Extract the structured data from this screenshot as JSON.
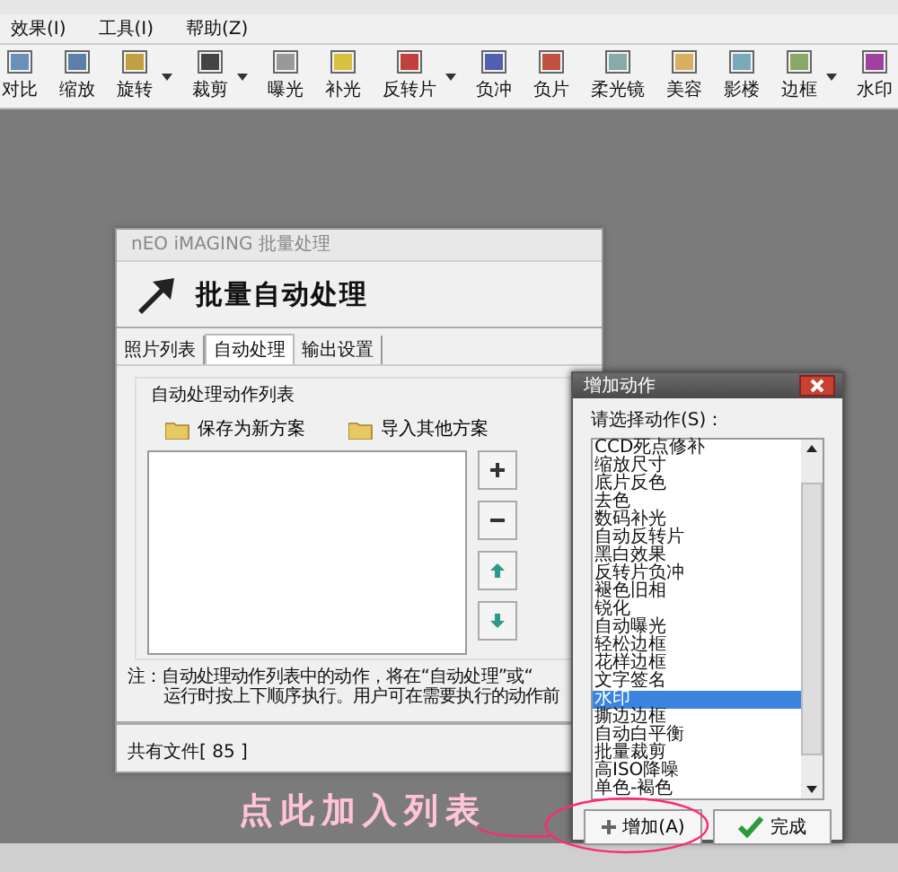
{
  "menu": [
    {
      "label": "效果(I)"
    },
    {
      "label": "工具(I)"
    },
    {
      "label": "帮助(Z)"
    }
  ],
  "toolbar": [
    {
      "label": "对比",
      "dropdown": false
    },
    {
      "label": "缩放",
      "dropdown": false
    },
    {
      "label": "旋转",
      "dropdown": true
    },
    {
      "label": "裁剪",
      "dropdown": true
    },
    {
      "label": "曝光",
      "dropdown": false
    },
    {
      "label": "补光",
      "dropdown": false
    },
    {
      "label": "反转片",
      "dropdown": true
    },
    {
      "label": "负冲",
      "dropdown": false
    },
    {
      "label": "负片",
      "dropdown": false
    },
    {
      "label": "柔光镜",
      "dropdown": false
    },
    {
      "label": "美容",
      "dropdown": false
    },
    {
      "label": "影楼",
      "dropdown": false
    },
    {
      "label": "边框",
      "dropdown": true
    },
    {
      "label": "水印",
      "dropdown": false
    }
  ],
  "main_dialog": {
    "title": "nEO iMAGING 批量处理",
    "heading": "批量自动处理",
    "tabs": [
      {
        "label": "照片列表",
        "selected": false
      },
      {
        "label": "自动处理",
        "selected": true
      },
      {
        "label": "输出设置",
        "selected": false
      }
    ],
    "group_label": "自动处理动作列表",
    "scheme_buttons": [
      "保存为新方案",
      "导入其他方案"
    ],
    "note_lines": [
      "注：自动处理动作列表中的动作，将在“自动处理”或“",
      "运行时按上下顺序执行。用户可在需要执行的动作前"
    ],
    "file_count": "共有文件[ 85 ]"
  },
  "popup": {
    "title": "增加动作",
    "prompt": "请选择动作(S)：",
    "actions": [
      {
        "label": "CCD死点修补",
        "selected": false
      },
      {
        "label": "缩放尺寸",
        "selected": false
      },
      {
        "label": "底片反色",
        "selected": false
      },
      {
        "label": "去色",
        "selected": false
      },
      {
        "label": "数码补光",
        "selected": false
      },
      {
        "label": "自动反转片",
        "selected": false
      },
      {
        "label": "黑白效果",
        "selected": false
      },
      {
        "label": "反转片负冲",
        "selected": false
      },
      {
        "label": "褪色旧相",
        "selected": false
      },
      {
        "label": "锐化",
        "selected": false
      },
      {
        "label": "自动曝光",
        "selected": false
      },
      {
        "label": "轻松边框",
        "selected": false
      },
      {
        "label": "花样边框",
        "selected": false
      },
      {
        "label": "文字签名",
        "selected": false
      },
      {
        "label": "水印",
        "selected": true
      },
      {
        "label": "撕边边框",
        "selected": false
      },
      {
        "label": "自动白平衡",
        "selected": false
      },
      {
        "label": "批量裁剪",
        "selected": false
      },
      {
        "label": "高ISO降噪",
        "selected": false
      },
      {
        "label": "单色-褐色",
        "selected": false
      }
    ],
    "buttons": [
      {
        "label": "增加(A)",
        "kind": "add"
      },
      {
        "label": "完成",
        "kind": "done"
      }
    ]
  },
  "annotation": {
    "text": "点此加入列表"
  }
}
